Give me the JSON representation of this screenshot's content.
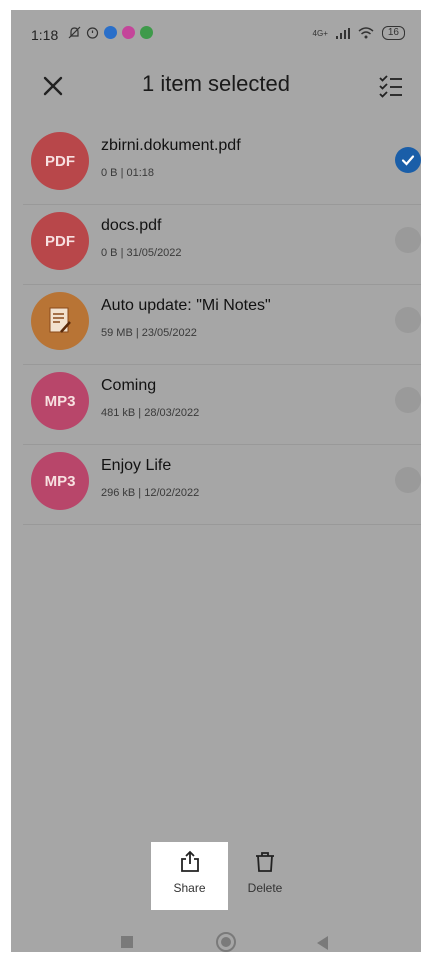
{
  "status": {
    "time": "1:18",
    "network": "4G+",
    "battery": "16",
    "notif_icons": [
      "silent-bell-icon",
      "alarm-icon",
      "messenger-icon",
      "instagram-icon",
      "spotify-icon"
    ]
  },
  "header": {
    "title": "1 item selected"
  },
  "files": [
    {
      "name": "zbirni.dokument.pdf",
      "meta": "0 B | 01:18",
      "type_label": "PDF",
      "kind": "pdf",
      "selected": true
    },
    {
      "name": "docs.pdf",
      "meta": "0 B | 31/05/2022",
      "type_label": "PDF",
      "kind": "pdf",
      "selected": false
    },
    {
      "name": "Auto update: \"Mi Notes\"",
      "meta": "59 MB | 23/05/2022",
      "type_label": "",
      "kind": "img",
      "selected": false
    },
    {
      "name": "Coming",
      "meta": "481 kB | 28/03/2022",
      "type_label": "MP3",
      "kind": "mp3",
      "selected": false
    },
    {
      "name": "Enjoy Life",
      "meta": "296 kB | 12/02/2022",
      "type_label": "MP3",
      "kind": "mp3",
      "selected": false
    }
  ],
  "actions": {
    "share": "Share",
    "delete": "Delete"
  },
  "colors": {
    "overlay_bg": "#a6a6a6",
    "selected_check": "#1a5ea8",
    "pdf_badge": "#b8474a",
    "mp3_badge": "#b8466a"
  }
}
